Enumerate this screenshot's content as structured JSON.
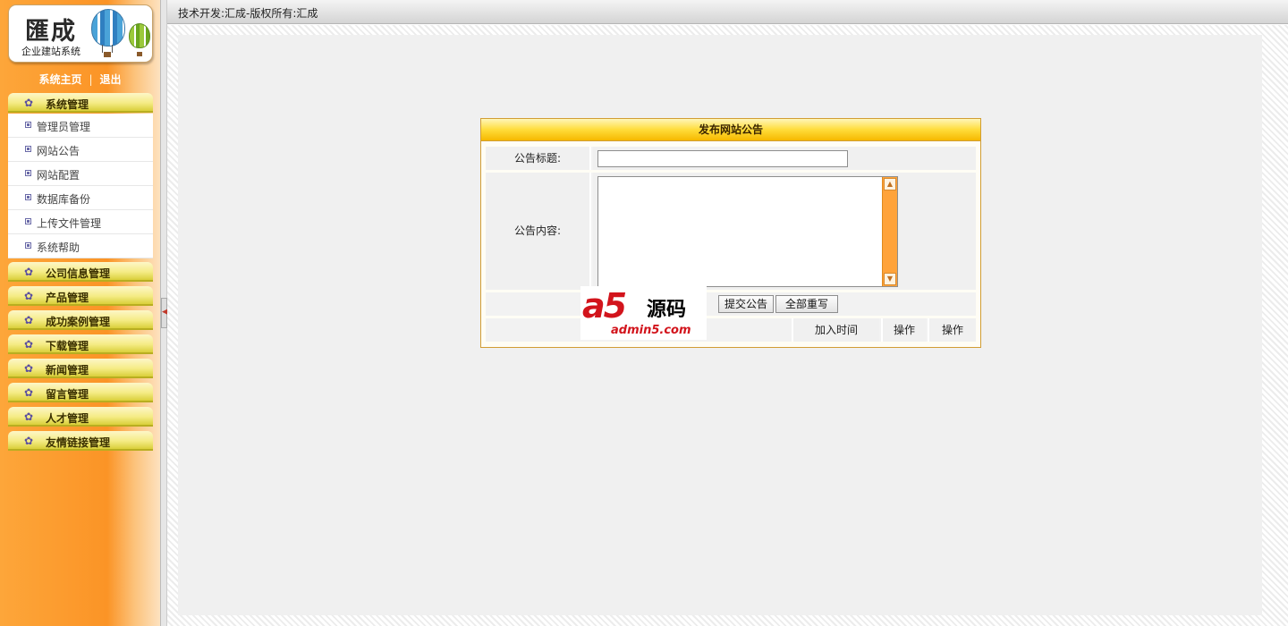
{
  "header": {
    "copyright": "技术开发:汇成-版权所有:汇成"
  },
  "logo": {
    "brand": "匯成",
    "subtitle": "企业建站系统"
  },
  "toplinks": {
    "home": "系统主页",
    "separator": "|",
    "logout": "退出"
  },
  "sidebar": {
    "groups": [
      {
        "label": "系统管理",
        "expanded": true
      },
      {
        "label": "公司信息管理"
      },
      {
        "label": "产品管理"
      },
      {
        "label": "成功案例管理"
      },
      {
        "label": "下载管理"
      },
      {
        "label": "新闻管理"
      },
      {
        "label": "留言管理"
      },
      {
        "label": "人才管理"
      },
      {
        "label": "友情链接管理"
      }
    ],
    "system_items": [
      {
        "label": "管理员管理"
      },
      {
        "label": "网站公告"
      },
      {
        "label": "网站配置"
      },
      {
        "label": "数据库备份"
      },
      {
        "label": "上传文件管理"
      },
      {
        "label": "系统帮助"
      }
    ]
  },
  "form": {
    "title": "发布网站公告",
    "title_label": "公告标题:",
    "title_value": "",
    "content_label": "公告内容:",
    "content_value": "",
    "submit_label": "提交公告",
    "reset_label": "全部重写"
  },
  "list": {
    "columns": [
      "加入时间",
      "操作",
      "操作"
    ]
  },
  "watermark": {
    "logo": "a5",
    "name": "源码",
    "url": "admin5.com"
  },
  "colors": {
    "sidebar_orange": "#fb9426",
    "menu_yellow": "#f5ec86",
    "panel_header": "#ffdc3a",
    "panel_border": "#d19d34",
    "watermark_red": "#d2141c"
  }
}
